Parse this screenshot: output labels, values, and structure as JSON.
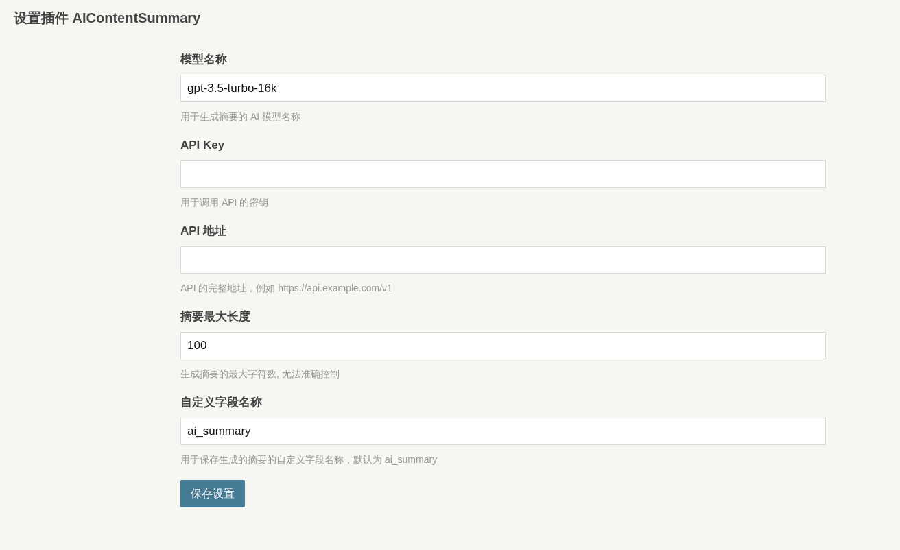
{
  "title": "设置插件 AIContentSummary",
  "fields": [
    {
      "label": "模型名称",
      "value": "gpt-3.5-turbo-16k",
      "hint": "用于生成摘要的 AI 模型名称"
    },
    {
      "label": "API Key",
      "hint": "用于调用 API 的密钥"
    },
    {
      "label": "API 地址",
      "hint": "API 的完整地址，例如 https://api.example.com/v1"
    },
    {
      "label": "摘要最大长度",
      "value": "100",
      "hint": "生成摘要的最大字符数, 无法准确控制"
    },
    {
      "label": "自定义字段名称",
      "value": "ai_summary",
      "hint": "用于保存生成的摘要的自定义字段名称，默认为 ai_summary"
    }
  ],
  "submit": "保存设置"
}
